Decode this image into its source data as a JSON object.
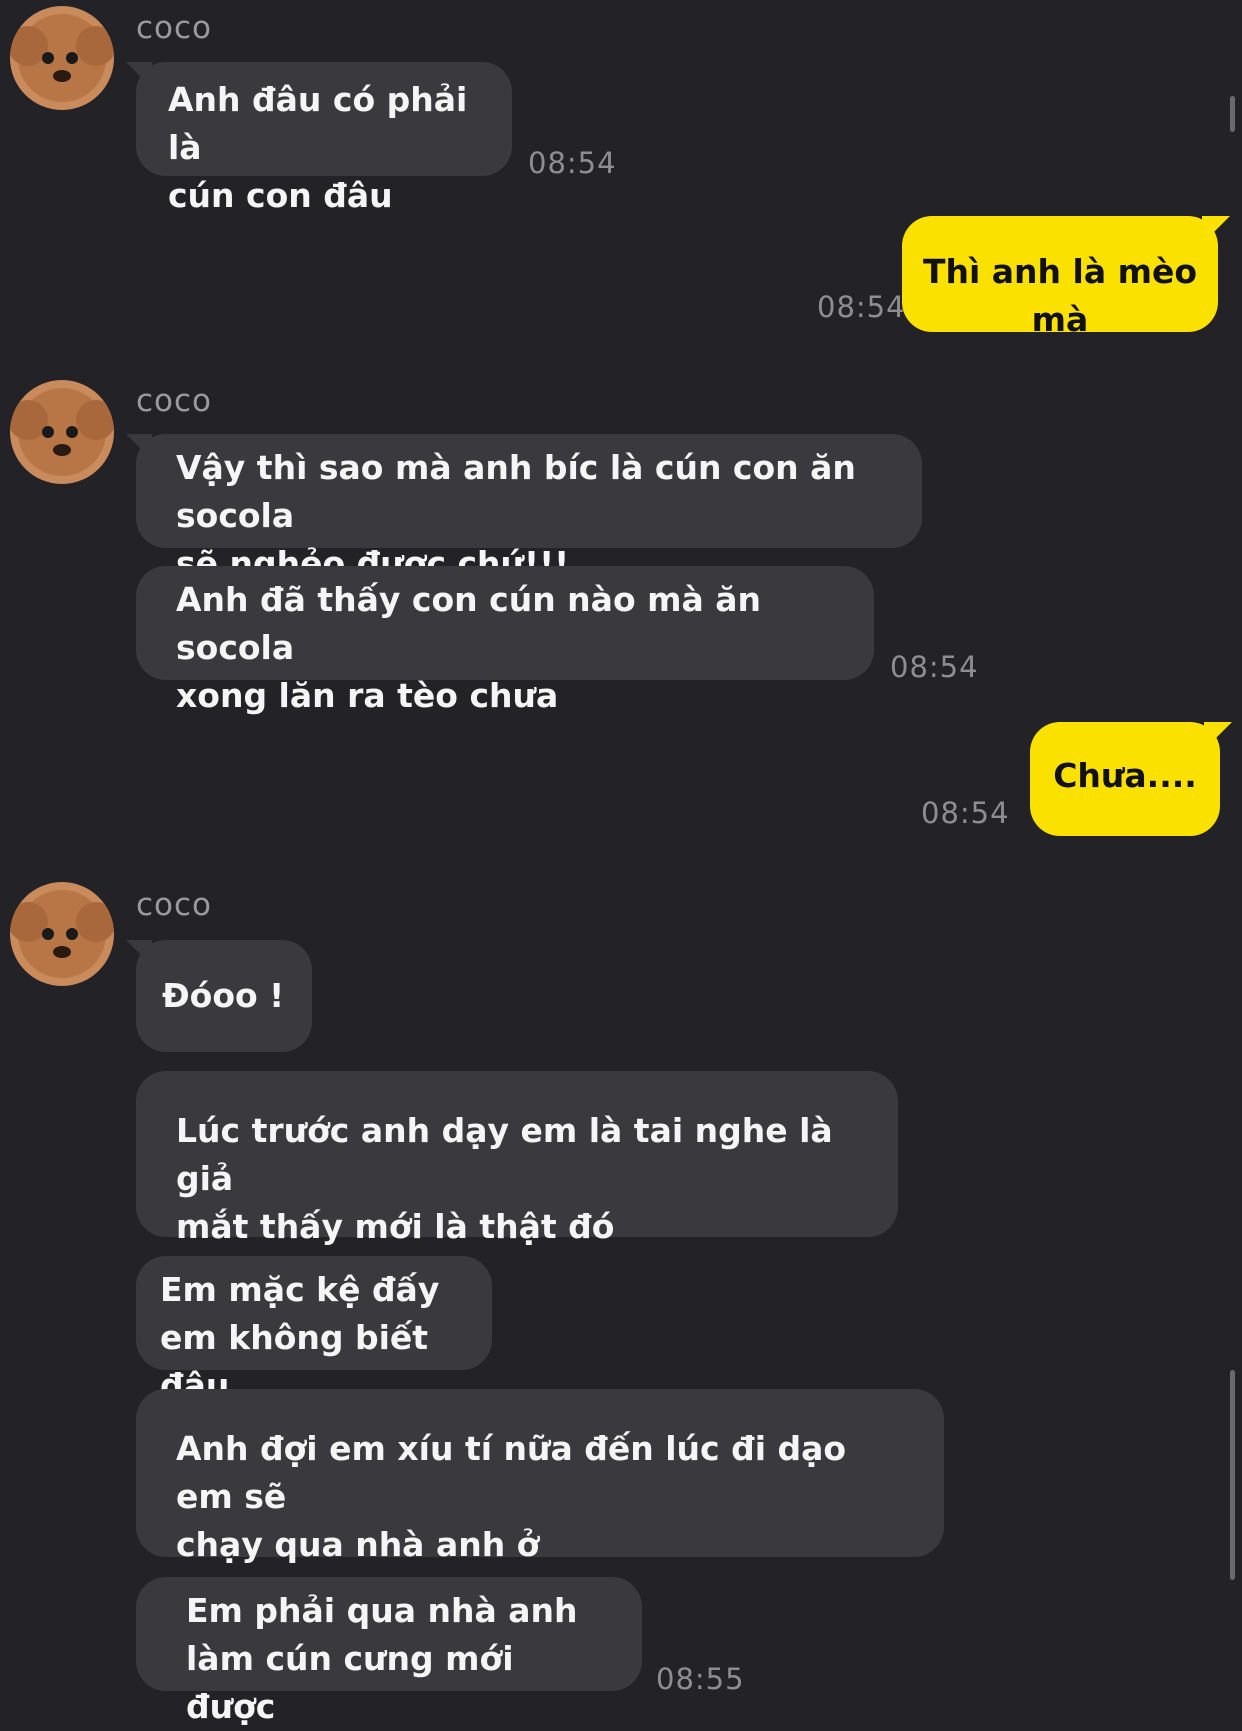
{
  "contact": {
    "name": "coco",
    "avatar_icon": "poodle-avatar-icon"
  },
  "colors": {
    "background": "#232226",
    "incoming_bubble": "#3a393e",
    "outgoing_bubble": "#fae100"
  },
  "groups": [
    {
      "sender": "coco",
      "messages": [
        "Anh đâu có phải là\ncún con đâu"
      ],
      "time": "08:54"
    },
    {
      "outgoing": true,
      "messages": [
        "Thì anh là mèo mà"
      ],
      "time": "08:54"
    },
    {
      "sender": "coco",
      "messages": [
        "Vậy thì sao mà anh bíc là cún con ăn socola\nsẽ nghẻo được chứ!!!",
        "Anh đã thấy con cún nào mà ăn socola\nxong lăn ra tèo chưa"
      ],
      "time": "08:54"
    },
    {
      "outgoing": true,
      "messages": [
        "Chưa...."
      ],
      "time": "08:54"
    },
    {
      "sender": "coco",
      "messages": [
        "Đóoo !",
        "Lúc trước anh dạy em là tai nghe là giả\nmắt thấy mới là thật đó",
        "Em mặc kệ đấy\nem không biết đâu",
        "Anh đợi em xíu tí nữa đến lúc đi dạo em sẽ\nchạy qua nhà anh ở",
        "Em phải qua nhà anh\nlàm cún cưng mới được"
      ],
      "time": "08:55"
    }
  ]
}
